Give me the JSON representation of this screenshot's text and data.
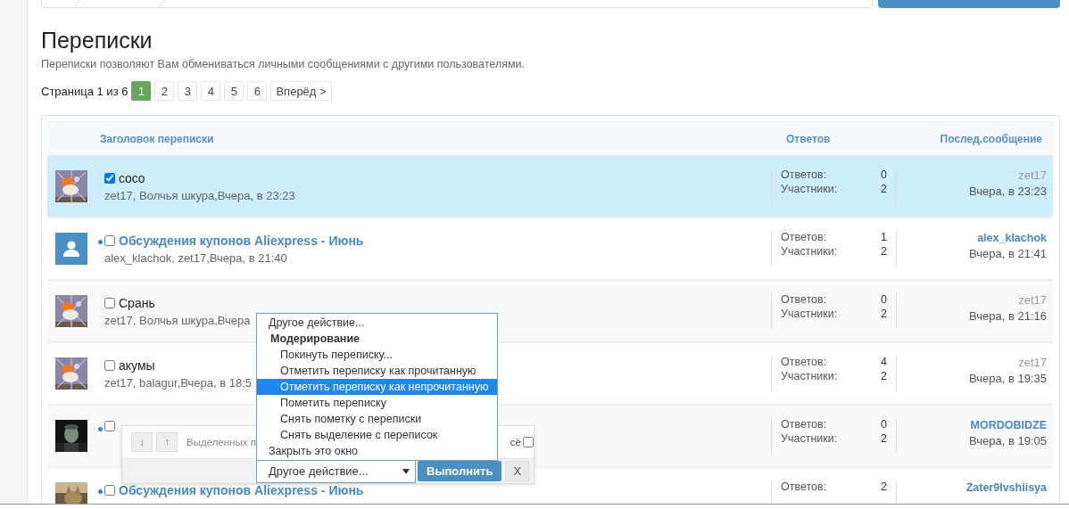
{
  "page": {
    "title": "Переписки",
    "description": "Переписки позволяют Вам обмениваться личными сообщениями с другими пользователями."
  },
  "pagination": {
    "label": "Страница 1 из 6",
    "pages": [
      {
        "label": "1",
        "selected": true
      },
      {
        "label": "2",
        "selected": false
      },
      {
        "label": "3",
        "selected": false
      },
      {
        "label": "4",
        "selected": false
      },
      {
        "label": "5",
        "selected": false
      },
      {
        "label": "6",
        "selected": false
      }
    ],
    "next": "Вперёд >"
  },
  "table": {
    "columns": [
      "Заголовок переписки",
      "Ответов",
      "Послед.сообщение"
    ],
    "rows": [
      {
        "unread": false,
        "checked": true,
        "selected": true,
        "title": "coco",
        "participants": "zet17, Волчья шкура,Вчера, в 23:23",
        "replies_label": "Ответов:",
        "replies": "0",
        "members_label": "Участники:",
        "members": "2",
        "last_user": "zet17",
        "last_time": "Вчера, в 23:23"
      },
      {
        "avatar": {
          "kind": "icon"
        },
        "unread": true,
        "checked": false,
        "selected": false,
        "title": "Обсуждения купонов Aliexpress - Июнь",
        "participants": "alex_klachok, zet17,Вчера, в 21:40",
        "replies_label": "Ответов:",
        "replies": "1",
        "members_label": "Участники:",
        "members": "2",
        "last_user": "alex_klachok",
        "last_time": "Вчера, в 21:41"
      },
      {
        "unread": false,
        "checked": false,
        "selected": false,
        "title": "Срань",
        "participants": "zet17, Волчья шкура,Вчера",
        "replies_label": "Ответов:",
        "replies": "0",
        "members_label": "Участники:",
        "members": "2",
        "last_user": "zet17",
        "last_time": "Вчера, в 21:16"
      },
      {
        "unread": false,
        "checked": false,
        "selected": false,
        "title": "акумы",
        "participants": "zet17, balagur,Вчера, в 18:5",
        "replies_label": "Ответов:",
        "replies": "4",
        "members_label": "Участники:",
        "members": "2",
        "last_user": "zet17",
        "last_time": "Вчера, в 19:35"
      },
      {
        "unread": true,
        "checked": false,
        "selected": false,
        "replies_label": "Ответов:",
        "replies": "0",
        "members_label": "Участники:",
        "members": "2",
        "last_user": "MORDOBIDZE",
        "last_time": "Вчера, в 19:05"
      },
      {
        "unread": true,
        "checked": false,
        "selected": false,
        "title": "Обсуждения купонов Aliexpress - Июнь",
        "replies_label": "Ответов:",
        "replies": "2",
        "last_user": "Zater9lvshiisya"
      }
    ]
  },
  "selection_bar": {
    "scroll_buttons": [
      "↓",
      "↑"
    ],
    "label": "Выделенных п",
    "select_all_label": "сё",
    "select_all_checked": false,
    "action_select": {
      "value": "Другое действие..."
    },
    "submit": "Выполнить",
    "close": "X"
  },
  "dropdown": {
    "options": [
      {
        "label": "Другое действие...",
        "kind": "option",
        "selected": false
      },
      {
        "label": "Модерирование",
        "kind": "group",
        "selected": false
      },
      {
        "label": "Покинуть переписку...",
        "kind": "suboption",
        "selected": false
      },
      {
        "label": "Отметить переписку как прочитанную",
        "kind": "suboption",
        "selected": false
      },
      {
        "label": "Отметить переписку как непрочитанную",
        "kind": "suboption",
        "selected": true
      },
      {
        "label": "Пометить переписку",
        "kind": "suboption",
        "selected": false
      },
      {
        "label": "Снять пометку с переписки",
        "kind": "suboption",
        "selected": false
      },
      {
        "label": "Снять выделение с переписок",
        "kind": "suboption",
        "selected": false
      },
      {
        "label": "Закрыть это окно",
        "kind": "option",
        "selected": false
      }
    ]
  }
}
